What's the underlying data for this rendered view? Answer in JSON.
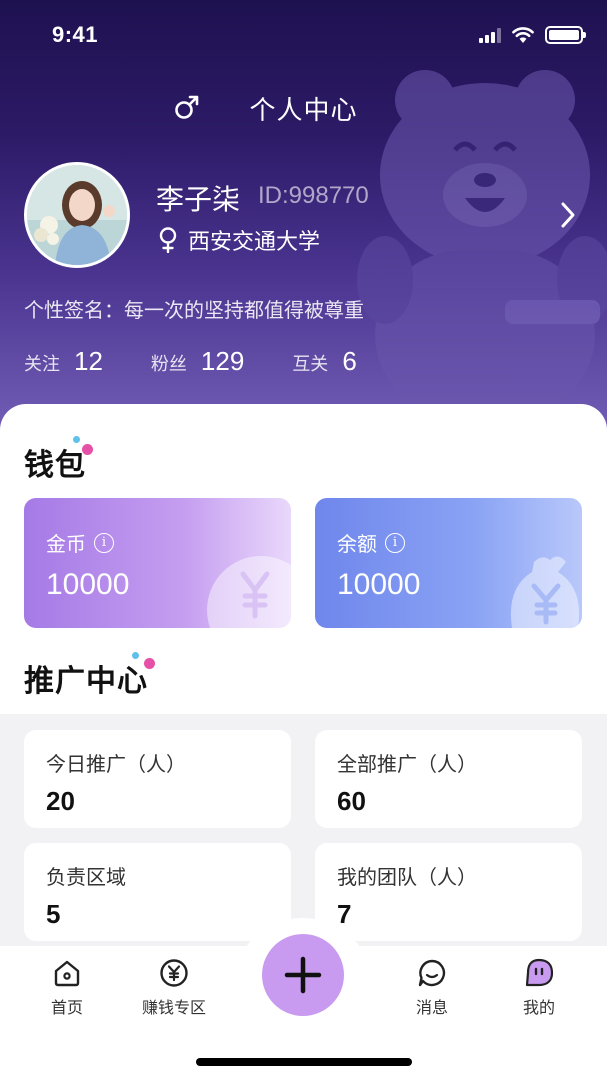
{
  "status_bar": {
    "time": "9:41"
  },
  "header": {
    "title": "个人中心",
    "gender_icon": "male-symbol-icon"
  },
  "profile": {
    "name": "李子柒",
    "id": "ID:998770",
    "school": "西安交通大学",
    "signature": "个性签名：每一次的坚持都值得被尊重",
    "stats": [
      {
        "label": "关注",
        "value": "12"
      },
      {
        "label": "粉丝",
        "value": "129"
      },
      {
        "label": "互关",
        "value": "6"
      }
    ]
  },
  "wallet": {
    "title": "钱包",
    "cards": [
      {
        "label": "金币",
        "value": "10000"
      },
      {
        "label": "余额",
        "value": "10000"
      }
    ]
  },
  "promotion": {
    "title": "推广中心",
    "cards": [
      {
        "label": "今日推广（人）",
        "value": "20"
      },
      {
        "label": "全部推广（人）",
        "value": "60"
      },
      {
        "label": "负责区域",
        "value": "5"
      },
      {
        "label": "我的团队（人）",
        "value": "7"
      }
    ]
  },
  "tab_bar": {
    "items": [
      {
        "label": "首页",
        "icon": "home-icon"
      },
      {
        "label": "赚钱专区",
        "icon": "yen-coin-icon"
      },
      {
        "label": "消息",
        "icon": "message-icon"
      },
      {
        "label": "我的",
        "icon": "profile-face-icon"
      }
    ],
    "fab_icon": "plus-icon"
  },
  "colors": {
    "header_dark": "#1e1150",
    "header_light": "#7460b8",
    "coin_card": "#a57ae6",
    "balance_card": "#6f86ec",
    "fab": "#c99bf0",
    "accent_pink": "#e651a8",
    "accent_blue": "#5fc0e8"
  }
}
